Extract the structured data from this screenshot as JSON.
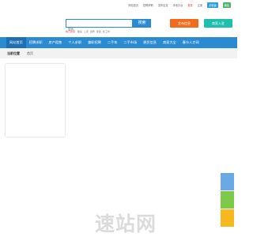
{
  "top_links": [
    {
      "text": "网站首页",
      "tone": "normal"
    },
    {
      "text": "招聘求职",
      "tone": "normal"
    },
    {
      "text": "发布信息",
      "tone": "normal"
    },
    {
      "text": "本地平台",
      "tone": "normal"
    },
    {
      "text": "登录",
      "tone": "red"
    },
    {
      "text": "注册",
      "tone": "normal"
    }
  ],
  "top_badges": {
    "blue": "手机版",
    "green": "微信"
  },
  "search": {
    "placeholder": "搜索",
    "button_label": "搜索"
  },
  "hot": {
    "label": "热门搜索:",
    "items": [
      "租房",
      "二手",
      "招聘",
      "家政",
      "找工作"
    ]
  },
  "actions": {
    "post_label": "发布信息",
    "join_label": "商家入驻"
  },
  "nav": {
    "items": [
      {
        "label": "网站首页",
        "active": true
      },
      {
        "label": "招聘求职",
        "active": false
      },
      {
        "label": "房产租售",
        "active": false
      },
      {
        "label": "个人求职",
        "active": false
      },
      {
        "label": "兼职招聘",
        "active": false
      },
      {
        "label": "二手车",
        "active": false
      },
      {
        "label": "二手市场",
        "active": false
      },
      {
        "label": "便民信息",
        "active": false
      },
      {
        "label": "商家大全",
        "active": false
      },
      {
        "label": "春节人才网",
        "active": false
      }
    ]
  },
  "location_strip": {
    "title": "当前位置",
    "item": "首页"
  },
  "side_buttons": {
    "colors": {
      "blue": "#6aa8e6",
      "green": "#7fc94a",
      "orange": "#f6b81f"
    }
  },
  "watermark": {
    "text": "速站网"
  }
}
